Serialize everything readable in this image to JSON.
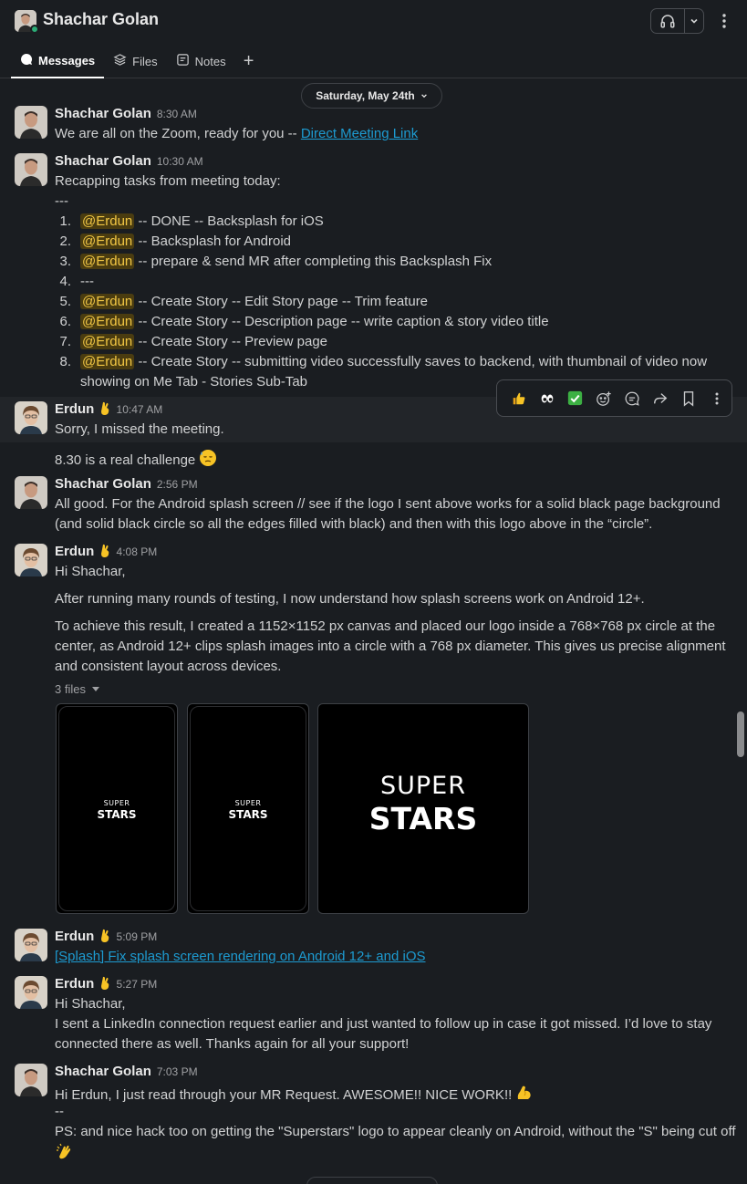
{
  "header": {
    "title": "Shachar Golan",
    "tabs": [
      {
        "label": "Messages",
        "icon": "message-bubble-icon"
      },
      {
        "label": "Files",
        "icon": "stack-icon"
      },
      {
        "label": "Notes",
        "icon": "notes-icon"
      }
    ],
    "add_tab": "+"
  },
  "date_divider": "Saturday, May 24th",
  "messages": [
    {
      "author": "Shachar Golan",
      "time": "8:30 AM",
      "text": "We are all on the Zoom, ready for you -- ",
      "link": "Direct Meeting Link"
    },
    {
      "author": "Shachar Golan",
      "time": "10:30 AM",
      "intro": "Recapping tasks from meeting today:",
      "sep": "---",
      "list": [
        {
          "num": "1.",
          "mention": "@Erdun",
          "text": " -- DONE -- Backsplash for iOS"
        },
        {
          "num": "2.",
          "mention": "@Erdun",
          "text": " -- Backsplash for Android"
        },
        {
          "num": "3.",
          "mention": "@Erdun",
          "text": " -- prepare & send MR after completing this Backsplash Fix"
        },
        {
          "num": "4.",
          "mention": "",
          "text": "---"
        },
        {
          "num": "5.",
          "mention": "@Erdun",
          "text": " -- Create Story -- Edit Story page -- Trim feature"
        },
        {
          "num": "6.",
          "mention": "@Erdun",
          "text": " -- Create Story -- Description page -- write caption & story video title"
        },
        {
          "num": "7.",
          "mention": "@Erdun",
          "text": " -- Create Story -- Preview page"
        },
        {
          "num": "8.",
          "mention": "@Erdun",
          "text": " -- Create Story -- submitting video successfully saves to backend, with thumbnail of video now",
          "cont": "showing on Me Tab - Stories Sub-Tab"
        }
      ]
    },
    {
      "author": "Erdun",
      "time": "10:47 AM",
      "text": "Sorry, I missed the meeting.",
      "text2": "8.30 is a real challenge"
    },
    {
      "author": "Shachar Golan",
      "time": "2:56 PM",
      "l1": "All good. For the Android splash screen // see if the logo I sent above works for a solid black page background",
      "l2": "(and solid black circle so all the edges filled with black) and then with this logo above in the “circle”."
    },
    {
      "author": "Erdun",
      "time": "4:08 PM",
      "p1": "Hi Shachar,",
      "p2": "After running many rounds of testing, I now understand how splash screens work on Android 12+.",
      "p3a": "To achieve this result, I created a 1152×1152 px canvas and placed our logo inside a 768×768 px circle at the",
      "p3b": "center, as Android 12+ clips splash images into a circle with a 768 px diameter. This gives us precise alignment",
      "p3c": "and consistent layout across devices.",
      "files_label": "3 files",
      "files": [
        {
          "top": "SUPER",
          "bottom": "STARS"
        },
        {
          "top": "SUPER",
          "bottom": "STARS"
        },
        {
          "top": "SUPER",
          "bottom": "STARS"
        }
      ]
    },
    {
      "author": "Erdun",
      "time": "5:09 PM",
      "link": "[Splash] Fix splash screen rendering on Android 12+ and iOS"
    },
    {
      "author": "Erdun",
      "time": "5:27 PM",
      "l1": "Hi Shachar,",
      "l2": "I sent a LinkedIn connection request earlier and just wanted to follow up in case it got missed. I’d love to stay",
      "l3": "connected there as well. Thanks again for all your support!"
    },
    {
      "author": "Shachar Golan",
      "time": "7:03 PM",
      "l1": "Hi Erdun, I just read through your MR Request. AWESOME!! NICE WORK!!",
      "l2": "--",
      "l3": "PS: and nice hack too on getting the \"Superstars\" logo to appear cleanly on Android, without the \"S\" being cut off"
    }
  ],
  "actions": [
    "thumbs-up-emoji",
    "eyes-emoji",
    "check-mark-emoji",
    "add-reaction-icon",
    "reply-thread-icon",
    "forward-icon",
    "bookmark-icon",
    "more-actions-icon"
  ],
  "colors": {
    "background": "#1a1d21",
    "link": "#1d9bd1",
    "mention_text": "#f2c744",
    "presence": "#2bac76"
  }
}
